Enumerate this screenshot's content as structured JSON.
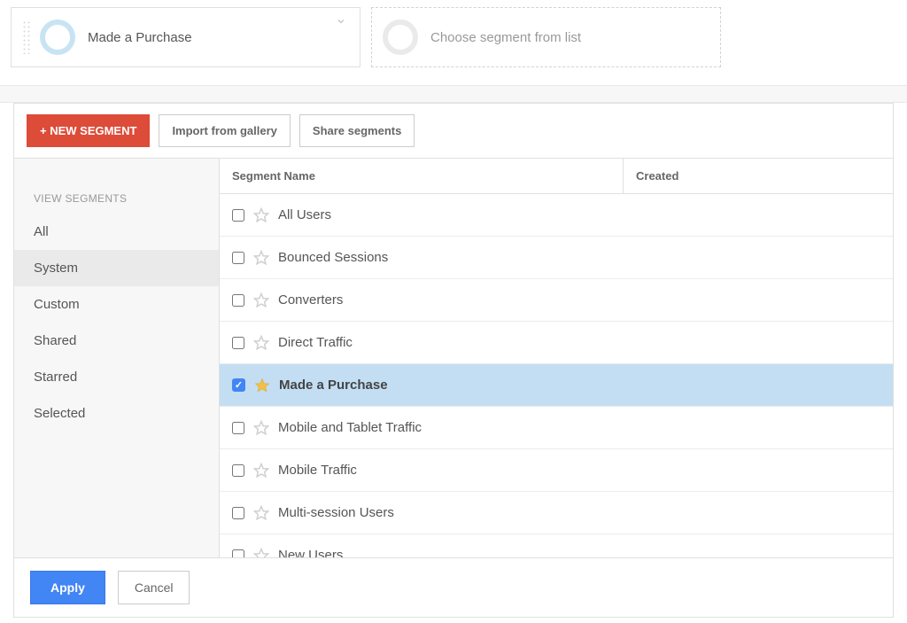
{
  "picker": {
    "selected_segment": "Made a Purchase",
    "placeholder_label": "Choose segment from list"
  },
  "toolbar": {
    "new_segment": "+ NEW SEGMENT",
    "import_gallery": "Import from gallery",
    "share_segments": "Share segments"
  },
  "sidebar": {
    "heading": "VIEW SEGMENTS",
    "items": [
      {
        "label": "All",
        "active": false
      },
      {
        "label": "System",
        "active": true
      },
      {
        "label": "Custom",
        "active": false
      },
      {
        "label": "Shared",
        "active": false
      },
      {
        "label": "Starred",
        "active": false
      },
      {
        "label": "Selected",
        "active": false
      }
    ]
  },
  "table": {
    "headers": {
      "name": "Segment Name",
      "created": "Created"
    },
    "rows": [
      {
        "name": "All Users",
        "checked": false,
        "starred": false
      },
      {
        "name": "Bounced Sessions",
        "checked": false,
        "starred": false
      },
      {
        "name": "Converters",
        "checked": false,
        "starred": false
      },
      {
        "name": "Direct Traffic",
        "checked": false,
        "starred": false
      },
      {
        "name": "Made a Purchase",
        "checked": true,
        "starred": true
      },
      {
        "name": "Mobile and Tablet Traffic",
        "checked": false,
        "starred": false
      },
      {
        "name": "Mobile Traffic",
        "checked": false,
        "starred": false
      },
      {
        "name": "Multi-session Users",
        "checked": false,
        "starred": false
      },
      {
        "name": "New Users",
        "checked": false,
        "starred": false
      }
    ]
  },
  "footer": {
    "apply": "Apply",
    "cancel": "Cancel"
  }
}
